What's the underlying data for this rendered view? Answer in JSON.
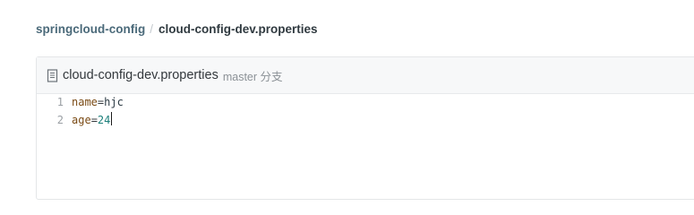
{
  "breadcrumb": {
    "repo": "springcloud-config",
    "separator": "/",
    "file": "cloud-config-dev.properties"
  },
  "file": {
    "icon": "file-icon",
    "name": "cloud-config-dev.properties",
    "branch_label": "master 分支"
  },
  "code": {
    "lines": [
      {
        "number": "1",
        "key": "name",
        "eq": "=",
        "value": "hjc"
      },
      {
        "number": "2",
        "key": "age",
        "eq": "=",
        "value": "24"
      }
    ]
  }
}
